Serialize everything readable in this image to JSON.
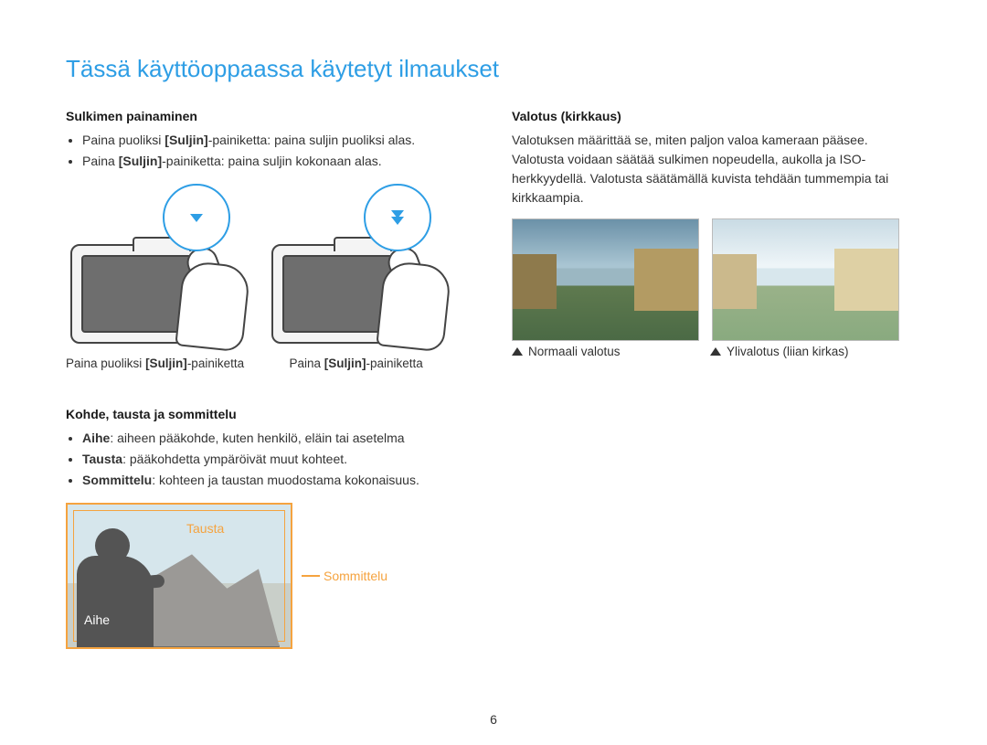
{
  "title": "Tässä käyttöoppaassa käytetyt ilmaukset",
  "page_number": "6",
  "left": {
    "shutter": {
      "heading": "Sulkimen painaminen",
      "line1_pre": "Paina puoliksi ",
      "line1_bold": "[Suljin]",
      "line1_post": "-painiketta: paina suljin puoliksi alas.",
      "line2_pre": "Paina ",
      "line2_bold": "[Suljin]",
      "line2_post": "-painiketta: paina suljin kokonaan alas.",
      "cap1_pre": "Paina puoliksi ",
      "cap1_bold": "[Suljin]",
      "cap1_post": "-painiketta",
      "cap2_pre": "Paina ",
      "cap2_bold": "[Suljin]",
      "cap2_post": "-painiketta"
    },
    "composition": {
      "heading": "Kohde, tausta ja sommittelu",
      "line1_bold": "Aihe",
      "line1_rest": ": aiheen pääkohde, kuten henkilö, eläin tai asetelma",
      "line2_bold": "Tausta",
      "line2_rest": ": pääkohdetta ympäröivät muut kohteet.",
      "line3_bold": "Sommittelu",
      "line3_rest": ": kohteen ja taustan muodostama kokonaisuus.",
      "label_tausta": "Tausta",
      "label_aihe": "Aihe",
      "label_sommittelu": "Sommittelu"
    }
  },
  "right": {
    "exposure": {
      "heading": "Valotus (kirkkaus)",
      "body": "Valotuksen määrittää se, miten paljon valoa kameraan pääsee. Valotusta voidaan säätää sulkimen nopeudella, aukolla ja ISO-herkkyydellä. Valotusta säätämällä kuvista tehdään tummempia tai kirkkaampia.",
      "cap_normal": "Normaali valotus",
      "cap_over": "Ylivalotus (liian kirkas)"
    }
  }
}
